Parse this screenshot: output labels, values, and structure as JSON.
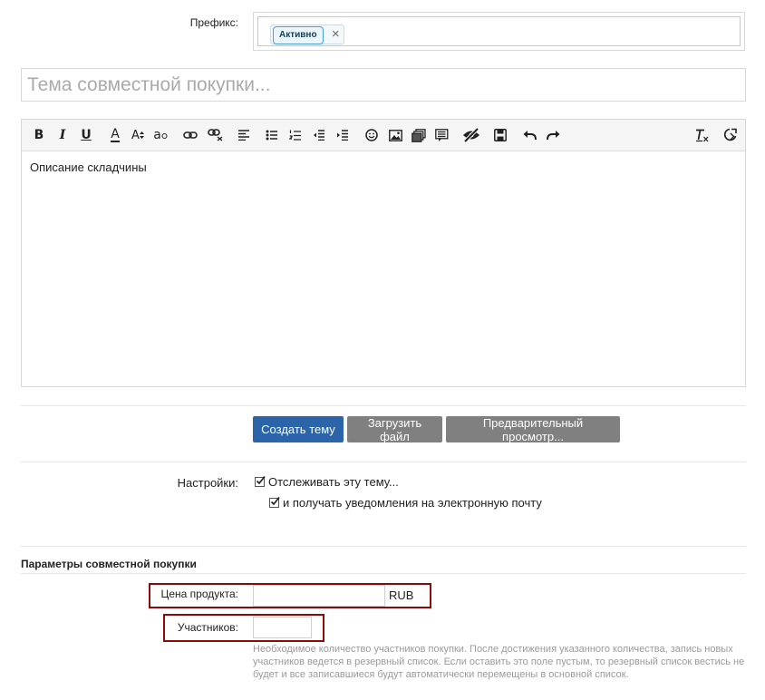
{
  "prefix": {
    "label": "Префикс:",
    "tag": "Активно",
    "remove_symbol": "×"
  },
  "title": {
    "placeholder": "Тема совместной покупки..."
  },
  "editor": {
    "toolbar": {
      "bold": "B",
      "italic": "I",
      "underline": "U",
      "font_color": "A",
      "font_size": "A",
      "font_family": "a"
    },
    "content": "Описание складчины"
  },
  "actions": {
    "create": "Создать тему",
    "upload": "Загрузить файл",
    "preview": "Предварительный просмотр..."
  },
  "settings": {
    "label": "Настройки:",
    "watch": "Отслеживать эту тему...",
    "email": "и получать уведомления на электронную почту"
  },
  "purchase_params": {
    "title": "Параметры совместной покупки",
    "price_label": "Цена продукта:",
    "price_value": "",
    "currency": "RUB",
    "participants_label": "Участников:",
    "participants_value": "",
    "help": "Необходимое количество участников покупки. После достижения указанного количества, запись новых участников ведется в резервный список. Если оставить это поле пустым, то резервный список вестись не будет и все записавшиеся будут автоматически перемещены в основной список."
  },
  "colors": {
    "primary_button": "#2b64a8",
    "secondary_button": "#808080",
    "highlight_frame": "#8b0a0a"
  }
}
